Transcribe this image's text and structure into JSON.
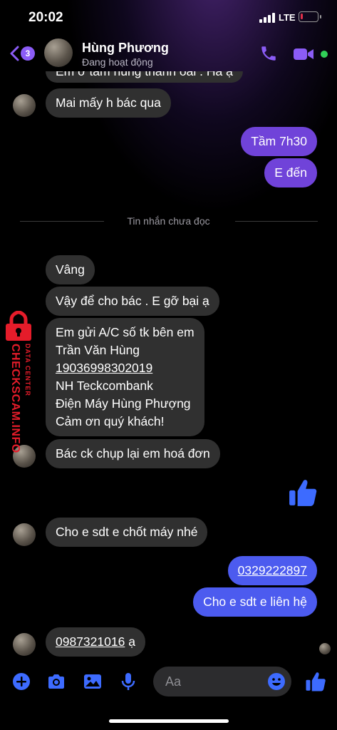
{
  "status_bar": {
    "time": "20:02",
    "network": "LTE",
    "battery_level": 0.15
  },
  "header": {
    "unread_count": "3",
    "contact_name": "Hùng Phương",
    "contact_status": "Đang hoạt động",
    "icons": [
      "back-chevron-icon",
      "phone-icon",
      "video-camera-icon"
    ],
    "accent_color": "#8b5cf6",
    "online_color": "#31d158"
  },
  "messages": {
    "cut_off_top": "Em ở tâm hùng thanh oai . Hà ạ",
    "m1": "Mai mấy h bác qua",
    "m2": "Tầm 7h30",
    "m3": "E đến",
    "unread_divider": "Tin nhắn chưa đọc",
    "m4": "Vâng",
    "m5": "Vậy để cho bác . E gỡ bại ạ",
    "m6": {
      "line1": "Em gửi A/C số tk bên em",
      "line2": "Trần Văn Hùng",
      "line3": "19036998302019",
      "line4": "NH Teckcombank",
      "line5": "Điện Máy Hùng Phượng",
      "line6": "Cảm ơn quý khách!"
    },
    "m7": "Bác ck chụp lại em hoá đơn",
    "m8": "Cho e sdt e chốt máy nhé",
    "m9": "0329222897",
    "m10": "Cho e sdt e liên hệ",
    "m11_number": "0987321016",
    "m11_suffix": " ạ"
  },
  "watermark": {
    "brand": "CHECKSCAM.INFO",
    "sub": "DATA CENTER"
  },
  "composer": {
    "placeholder": "Aa",
    "icons": [
      "plus-icon",
      "camera-icon",
      "gallery-icon",
      "microphone-icon",
      "emoji-icon",
      "thumbs-up-icon"
    ]
  },
  "colors": {
    "incoming_bubble": "#303030",
    "outgoing_purple": "#7043d9",
    "outgoing_blue": "#4c5bef",
    "watermark_red": "#e51c2a"
  }
}
